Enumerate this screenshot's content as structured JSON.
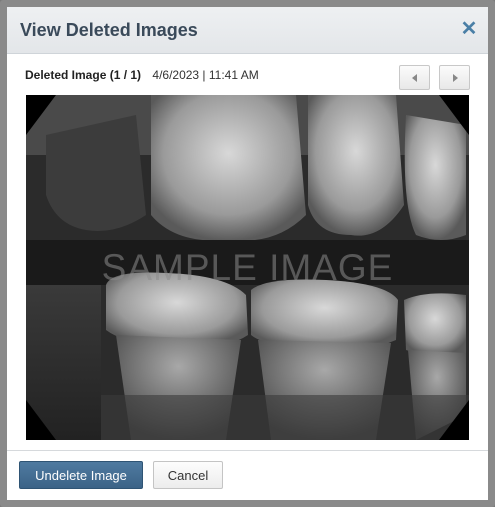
{
  "dialog": {
    "title": "View Deleted Images",
    "close_icon": "close-icon"
  },
  "image_info": {
    "title": "Deleted Image (1 / 1)",
    "date": "4/6/2023 | 11:41 AM"
  },
  "navigation": {
    "prev_icon": "chevron-left-icon",
    "next_icon": "chevron-right-icon"
  },
  "image": {
    "watermark": "SAMPLE IMAGE",
    "description_icon": "dental-xray-image"
  },
  "footer": {
    "undelete_label": "Undelete Image",
    "cancel_label": "Cancel"
  },
  "colors": {
    "primary_button": "#3b6387",
    "header_title": "#3a4a5a",
    "close_icon": "#4a7fa6"
  }
}
